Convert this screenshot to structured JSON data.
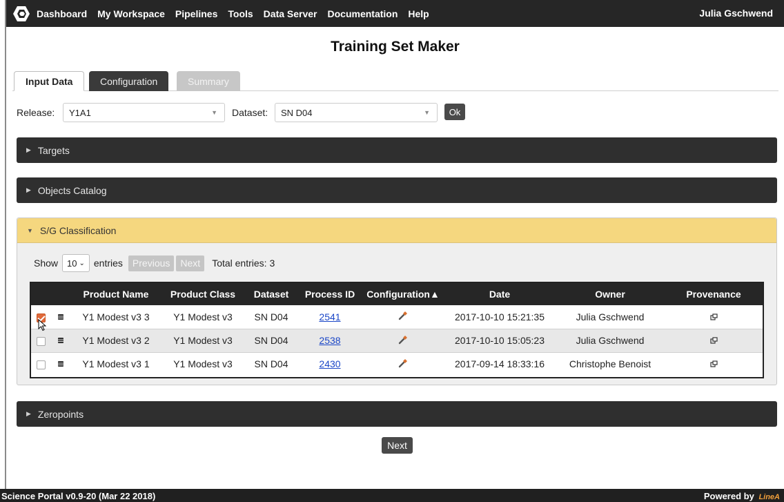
{
  "nav": {
    "items": [
      "Dashboard",
      "My Workspace",
      "Pipelines",
      "Tools",
      "Data Server",
      "Documentation",
      "Help"
    ],
    "user": "Julia Gschwend"
  },
  "page": {
    "title": "Training Set Maker"
  },
  "tabs": [
    "Input Data",
    "Configuration",
    "Summary"
  ],
  "filters": {
    "release_label": "Release:",
    "release_value": "Y1A1",
    "dataset_label": "Dataset:",
    "dataset_value": "SN D04",
    "ok_label": "Ok"
  },
  "panels": {
    "targets": "Targets",
    "objects": "Objects Catalog",
    "sg": "S/G Classification",
    "zeropoints": "Zeropoints"
  },
  "table": {
    "show_label": "Show",
    "page_size": "10",
    "entries_label": "entries",
    "prev": "Previous",
    "next": "Next",
    "total": "Total entries: 3",
    "headers": [
      "Product Name",
      "Product Class",
      "Dataset",
      "Process ID",
      "Configuration▲",
      "Date",
      "Owner",
      "Provenance"
    ],
    "rows": [
      [
        "Y1 Modest v3 3",
        "Y1 Modest v3",
        "SN D04",
        "2541",
        "2017-10-10 15:21:35",
        "Julia Gschwend"
      ],
      [
        "Y1 Modest v3 2",
        "Y1 Modest v3",
        "SN D04",
        "2538",
        "2017-10-10 15:05:23",
        "Julia Gschwend"
      ],
      [
        "Y1 Modest v3 1",
        "Y1 Modest v3",
        "SN D04",
        "2430",
        "2017-09-14 18:33:16",
        "Christophe Benoist"
      ]
    ]
  },
  "next_button": "Next",
  "footer": {
    "version": "Science Portal v0.9-20 (Mar 22 2018)",
    "powered": "Powered by",
    "brand": "LineA"
  },
  "colors": {
    "nav_bg": "#262626",
    "panel_dark": "#2f2f2f",
    "panel_active": "#f5d77f",
    "checkbox_checked": "#e06a3b",
    "link": "#1a46c7"
  }
}
